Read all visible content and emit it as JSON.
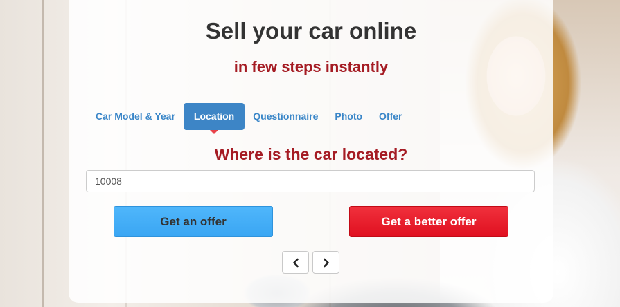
{
  "hero": {
    "title": "Sell your car online",
    "subtitle": "in few steps instantly"
  },
  "tabs": [
    {
      "label": "Car Model & Year",
      "active": false
    },
    {
      "label": "Location",
      "active": true
    },
    {
      "label": "Questionnaire",
      "active": false
    },
    {
      "label": "Photo",
      "active": false
    },
    {
      "label": "Offer",
      "active": false
    }
  ],
  "step": {
    "question": "Where is the car located?",
    "zip_value": "10008"
  },
  "actions": {
    "get_offer_label": "Get an offer",
    "better_offer_label": "Get a better offer"
  },
  "pager": {
    "prev_icon": "chevron-left-icon",
    "next_icon": "chevron-right-icon"
  },
  "colors": {
    "title": "#333333",
    "accent_red": "#a51c24",
    "tab_text": "#3a86c8",
    "tab_active_bg": "#3d85c6",
    "offer_btn_bg": "#3aa6f3",
    "offer_btn_text": "#333333",
    "better_btn_bg": "#e01020",
    "better_btn_text": "#ffffff"
  }
}
